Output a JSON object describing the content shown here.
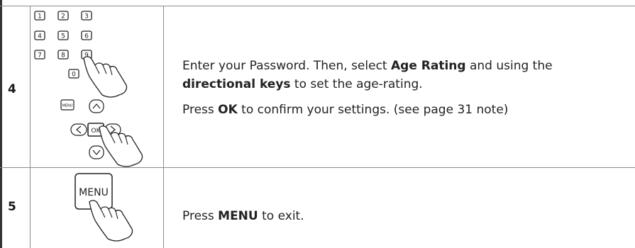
{
  "steps": [
    {
      "number": "4",
      "keypad": {
        "digits": [
          "1",
          "2",
          "3",
          "4",
          "5",
          "6",
          "7",
          "8",
          "9",
          "0"
        ],
        "menu_label": "MENU",
        "up_label": "^",
        "left_label": "<",
        "ok_label": "OK",
        "right_label": ">",
        "down_label": "v"
      },
      "line1_pre": "Enter your Password. Then, select ",
      "line1_bold": "Age Rating",
      "line1_post": " and using the",
      "line2_bold": "directional keys",
      "line2_post": " to set the age-rating.",
      "line3_pre": "Press ",
      "line3_bold": "OK",
      "line3_post": " to confirm your settings. (see page 31 note)"
    },
    {
      "number": "5",
      "button_label": "MENU",
      "line1_pre": "Press ",
      "line1_bold": "MENU",
      "line1_post": " to exit."
    }
  ],
  "colors": {
    "border": "#8a8a8a",
    "thick_border": "#333333",
    "text": "#222222"
  }
}
